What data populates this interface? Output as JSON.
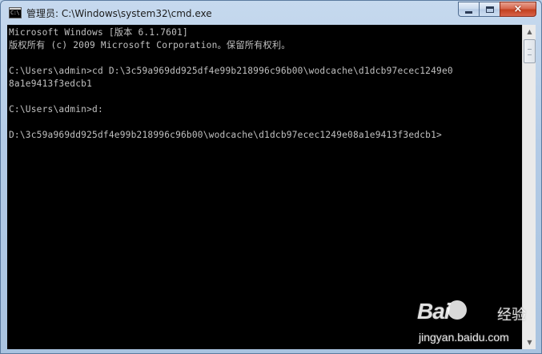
{
  "window": {
    "title": "管理员: C:\\Windows\\system32\\cmd.exe",
    "icon": "cmd-icon",
    "icon_text": "C:\\",
    "controls": {
      "minimize": "minimize-icon",
      "maximize": "maximize-icon",
      "close": "×"
    }
  },
  "console": {
    "lines": [
      "Microsoft Windows [版本 6.1.7601]",
      "版权所有 (c) 2009 Microsoft Corporation。保留所有权利。",
      "",
      "C:\\Users\\admin>cd D:\\3c59a969dd925df4e99b218996c96b00\\wodcache\\d1dcb97ecec1249e0",
      "8a1e9413f3edcb1",
      "",
      "C:\\Users\\admin>d:",
      "",
      "D:\\3c59a969dd925df4e99b218996c96b00\\wodcache\\d1dcb97ecec1249e08a1e9413f3edcb1>"
    ]
  },
  "scrollbar": {
    "up": "▲",
    "down": "▼"
  },
  "watermark": {
    "logo": "Bai",
    "logo_suffix": "",
    "label": "经验",
    "url": "jingyan.baidu.com"
  },
  "colors": {
    "console_bg": "#000000",
    "console_fg": "#c0c0c0",
    "frame": "#b3cbe6",
    "close_button": "#c7432a"
  }
}
